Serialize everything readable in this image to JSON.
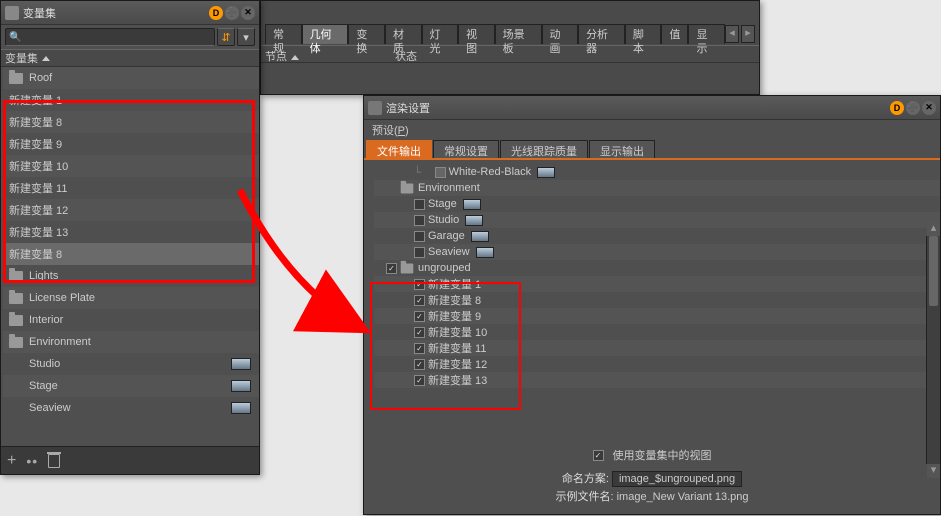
{
  "left": {
    "title": "变量集",
    "hdr": "变量集",
    "rows": [
      {
        "t": "folder",
        "label": "Roof"
      },
      {
        "t": "item",
        "label": "新建变量 1"
      },
      {
        "t": "item",
        "label": "新建变量 8"
      },
      {
        "t": "item",
        "label": "新建变量 9"
      },
      {
        "t": "item",
        "label": "新建变量 10"
      },
      {
        "t": "item",
        "label": "新建变量 11"
      },
      {
        "t": "item",
        "label": "新建变量 12"
      },
      {
        "t": "item",
        "label": "新建变量 13"
      },
      {
        "t": "item",
        "label": "新建变量 8",
        "sel": true
      },
      {
        "t": "folder",
        "label": "Lights"
      },
      {
        "t": "folder",
        "label": "License Plate"
      },
      {
        "t": "folder",
        "label": "Interior"
      },
      {
        "t": "folder",
        "label": "Environment",
        "open": true
      },
      {
        "t": "sub",
        "label": "Studio",
        "thumb": true
      },
      {
        "t": "sub",
        "label": "Stage",
        "thumb": true
      },
      {
        "t": "sub",
        "label": "Seaview",
        "thumb": true
      }
    ]
  },
  "prop": {
    "tabs": [
      "常规",
      "几何体",
      "变换",
      "材质",
      "灯光",
      "视图",
      "场景板",
      "动画",
      "分析器",
      "脚本",
      "值",
      "显示"
    ],
    "selectedTab": 1,
    "subCols": [
      "节点",
      "状态"
    ]
  },
  "render": {
    "title": "渲染设置",
    "preset": "预设(",
    "presetKey": "P",
    "presetEnd": ")",
    "tabs": [
      "文件输出",
      "常规设置",
      "光线跟踪质量",
      "显示输出"
    ],
    "selectedTab": 0,
    "tree": [
      {
        "ind": 1,
        "chk": false,
        "checked": false,
        "square": true,
        "label": "White-Red-Black",
        "thumb": true,
        "conn": "└"
      },
      {
        "ind": 0,
        "chk": false,
        "folder": true,
        "label": "Environment"
      },
      {
        "ind": 1,
        "chk": true,
        "checked": false,
        "label": "Stage",
        "thumb": true
      },
      {
        "ind": 1,
        "chk": true,
        "checked": false,
        "label": "Studio",
        "thumb": true
      },
      {
        "ind": 1,
        "chk": true,
        "checked": false,
        "label": "Garage",
        "thumb": true
      },
      {
        "ind": 1,
        "chk": true,
        "checked": false,
        "label": "Seaview",
        "thumb": true
      },
      {
        "ind": 0,
        "chk": true,
        "checked": true,
        "folder": true,
        "label": "ungrouped"
      },
      {
        "ind": 1,
        "chk": true,
        "checked": true,
        "label": "新建变量 1"
      },
      {
        "ind": 1,
        "chk": true,
        "checked": true,
        "label": "新建变量 8"
      },
      {
        "ind": 1,
        "chk": true,
        "checked": true,
        "label": "新建变量 9"
      },
      {
        "ind": 1,
        "chk": true,
        "checked": true,
        "label": "新建变量 10"
      },
      {
        "ind": 1,
        "chk": true,
        "checked": true,
        "label": "新建变量 11"
      },
      {
        "ind": 1,
        "chk": true,
        "checked": true,
        "label": "新建变量 12"
      },
      {
        "ind": 1,
        "chk": true,
        "checked": true,
        "label": "新建变量 13"
      }
    ],
    "useView": "使用变量集中的视图",
    "namingLabel": "命名方案:",
    "namingVal": "image_$ungrouped.png",
    "exampleLabel": "示例文件名:",
    "exampleVal": "image_New Variant 13.png"
  },
  "icons": {
    "D": "D"
  }
}
